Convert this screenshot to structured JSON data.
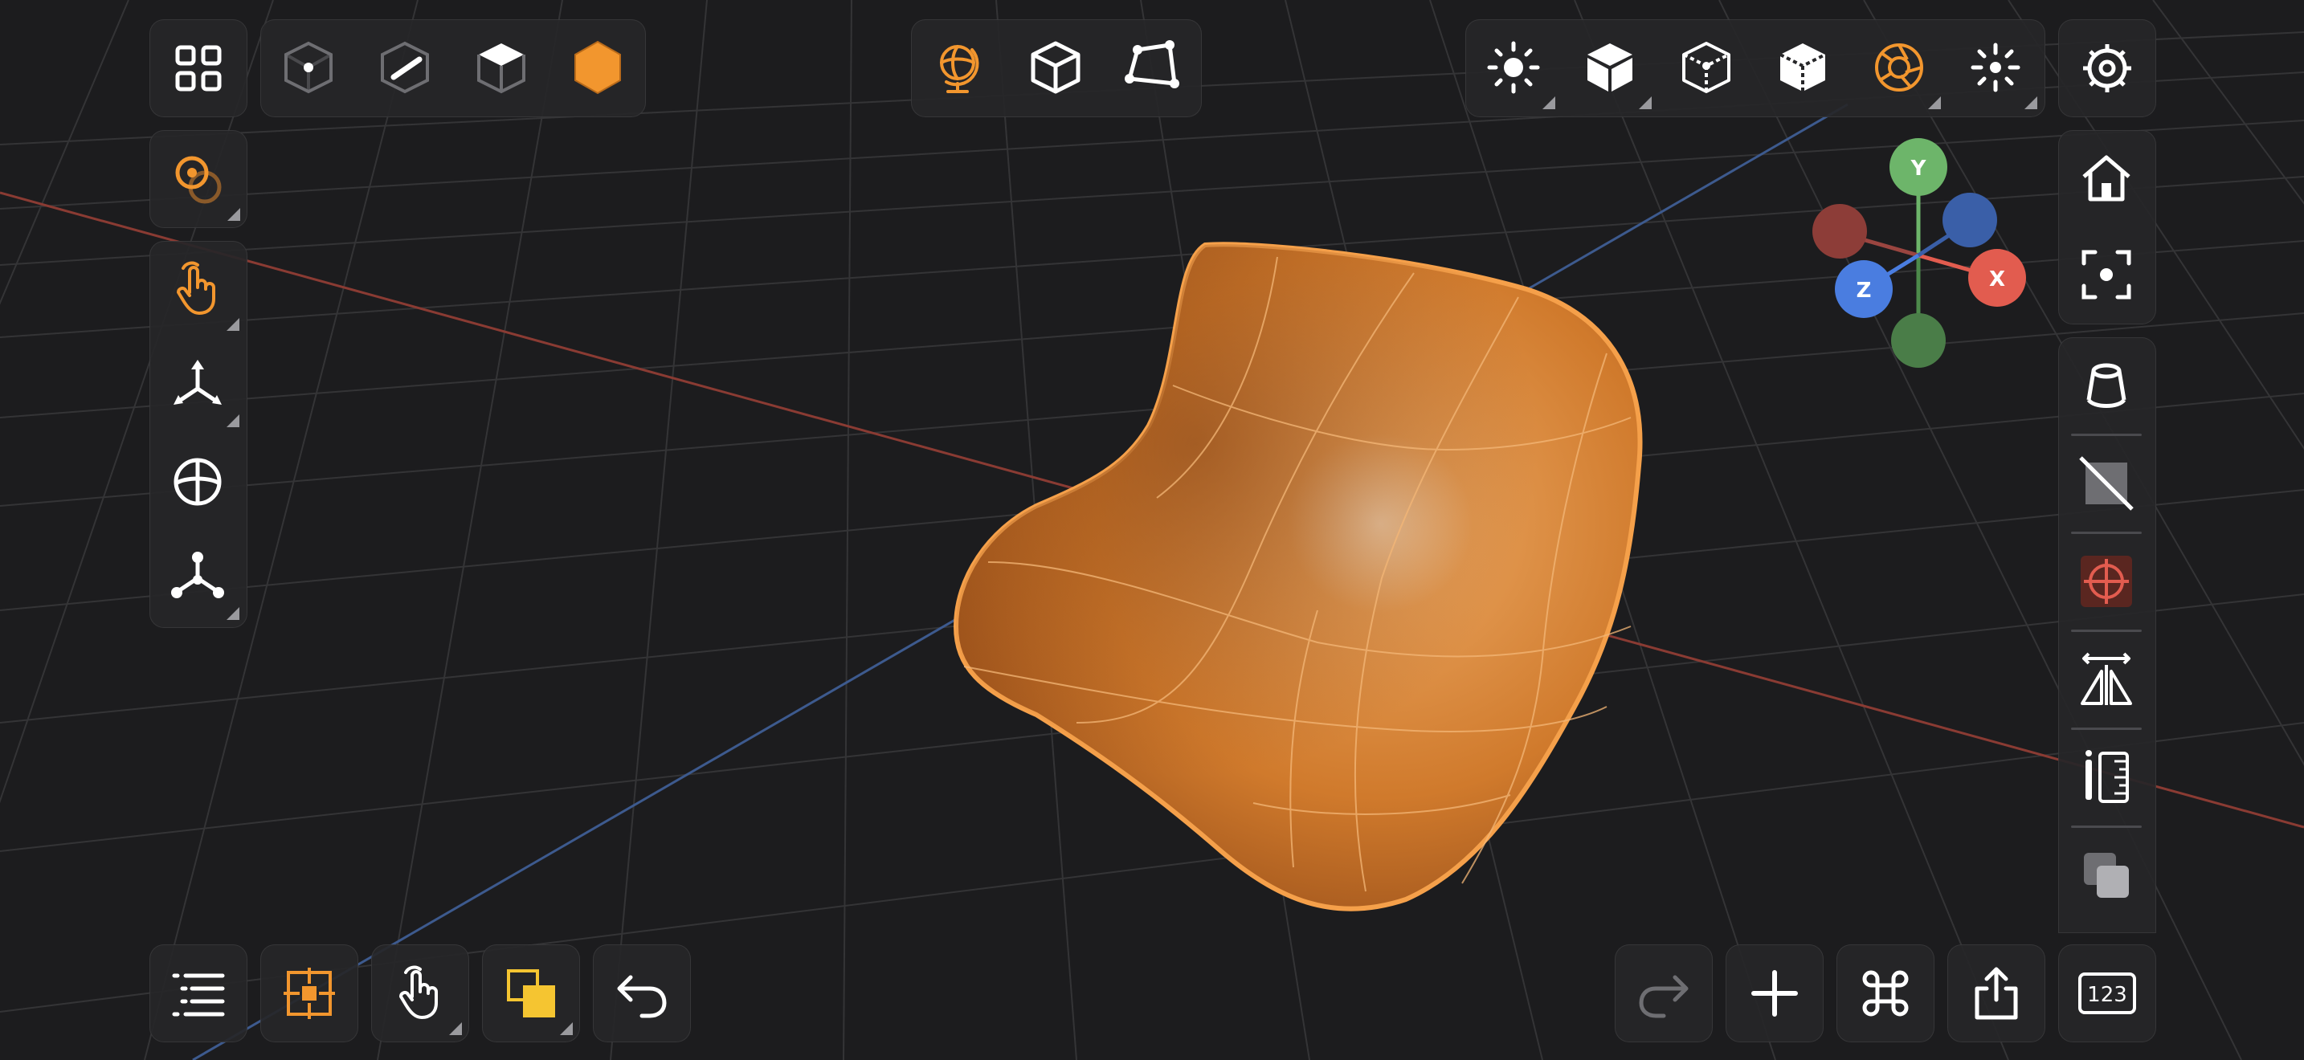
{
  "colors": {
    "background": "#1c1c1e",
    "panel": "#262628",
    "icon": "#ffffff",
    "accent": "#f2962e",
    "grid": "#3a3a3c",
    "axis_x": "#e25c4f",
    "axis_y": "#6db56a",
    "axis_z": "#4a7de0",
    "highlight_yellow": "#f5c531",
    "disabled": "#6e6e72"
  },
  "gizmo": {
    "x_label": "X",
    "y_label": "Y",
    "z_label": "Z"
  },
  "toolbar_top_left": {
    "icons": [
      "grid-apps-icon"
    ]
  },
  "selection_modes": {
    "icons": [
      "vertex-mode-icon",
      "edge-mode-icon",
      "face-mode-icon",
      "object-mode-icon"
    ],
    "active": "object-mode-icon"
  },
  "top_center": {
    "icons": [
      "globe-icon",
      "cube-outline-icon",
      "quad-polygon-icon"
    ]
  },
  "top_right": {
    "icons": [
      "sun-icon",
      "solid-cube-icon",
      "wireframe-cube-icon",
      "xray-cube-icon",
      "aperture-icon",
      "dotted-sun-icon"
    ]
  },
  "bottom_right": {
    "numeric_label": "123"
  }
}
